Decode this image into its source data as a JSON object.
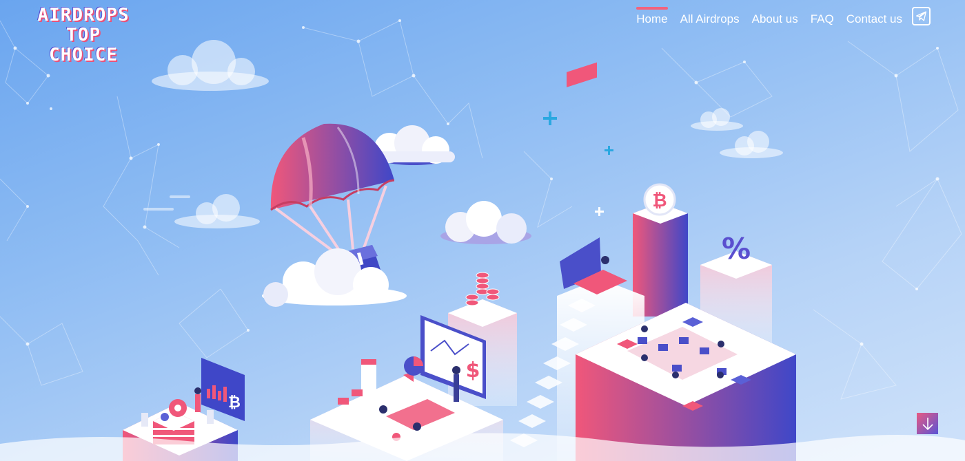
{
  "logo": {
    "lines": [
      "AIRDROPS",
      "TOP",
      "CHOICE"
    ]
  },
  "nav": {
    "items": [
      {
        "label": "Home",
        "active": true
      },
      {
        "label": "All Airdrops",
        "active": false
      },
      {
        "label": "About us",
        "active": false
      },
      {
        "label": "FAQ",
        "active": false
      },
      {
        "label": "Contact us",
        "active": false
      }
    ],
    "telegram_icon": "telegram-plane-icon"
  },
  "illustration": {
    "coin_symbol": "₿",
    "percent_symbol": "%",
    "dollar_symbol": "$",
    "elements": [
      "parachute-airdrop",
      "bitcoin-tower",
      "percent-tower",
      "team-office",
      "presentation-screen",
      "coin-stack",
      "server-rack"
    ]
  },
  "scroll_down_icon": "arrow-down-icon",
  "colors": {
    "accent_pink": "#f2637d",
    "accent_blue": "#4a4fd0",
    "sky": "#8ebcf3"
  }
}
